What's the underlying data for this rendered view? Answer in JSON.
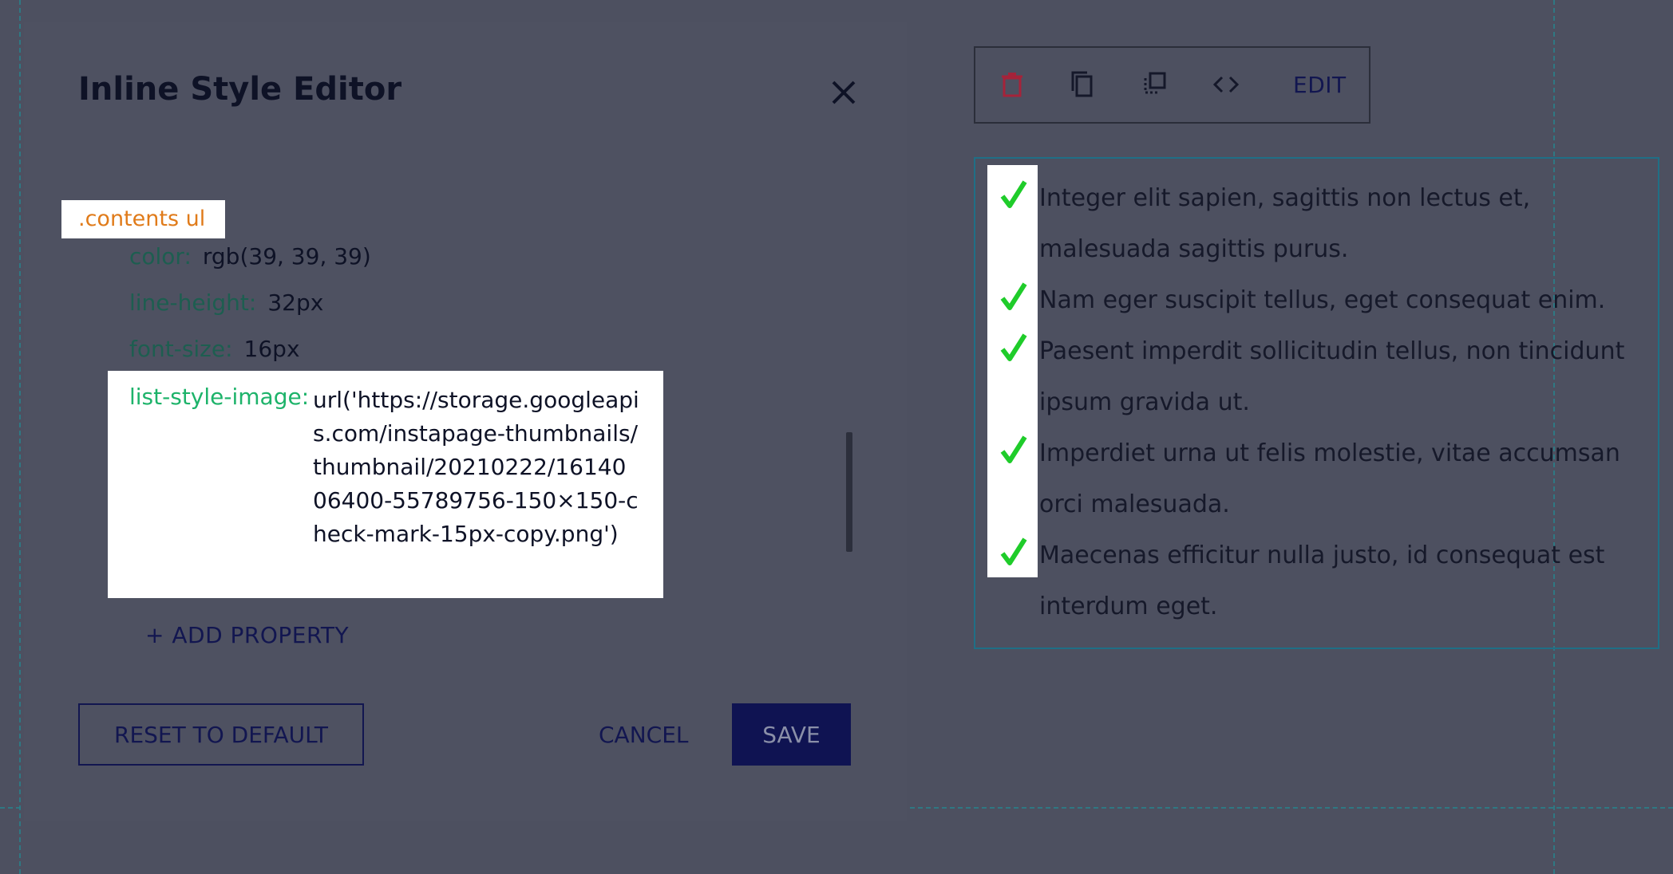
{
  "modal": {
    "title": "Inline Style Editor",
    "selector": ".contents ul",
    "properties": [
      {
        "key": "color:",
        "value": "rgb(39, 39, 39)"
      },
      {
        "key": "line-height:",
        "value": "32px"
      },
      {
        "key": "font-size:",
        "value": "16px"
      }
    ],
    "focused_property": {
      "key": "list-style-image:",
      "value": "url('https://storage.googleapis.com/instapage-thumbnails/thumbnail/20210222/1614006400-55789756-150×150-check-mark-15px-copy.png')"
    },
    "add_property_label": "+ ADD PROPERTY",
    "reset_label": "RESET TO DEFAULT",
    "cancel_label": "CANCEL",
    "save_label": "SAVE"
  },
  "toolbar": {
    "icons": [
      "delete-icon",
      "copy-icon",
      "duplicate-icon",
      "code-icon"
    ],
    "edit_label": "EDIT",
    "delete_color": "#a5233a"
  },
  "content": {
    "items": [
      "Integer elit sapien, sagittis non lectus et, malesuada sagittis purus.",
      "Nam eger suscipit tellus, eget consequat enim.",
      "Paesent imperdit sollicitudin tellus, non tincidunt ipsum gravida ut.",
      "Imperdiet urna ut felis molestie, vitae accumsan orci malesuada.",
      "Maecenas efficitur nulla justo, id consequat est interdum eget."
    ],
    "check_color": "#1fcc2a"
  }
}
